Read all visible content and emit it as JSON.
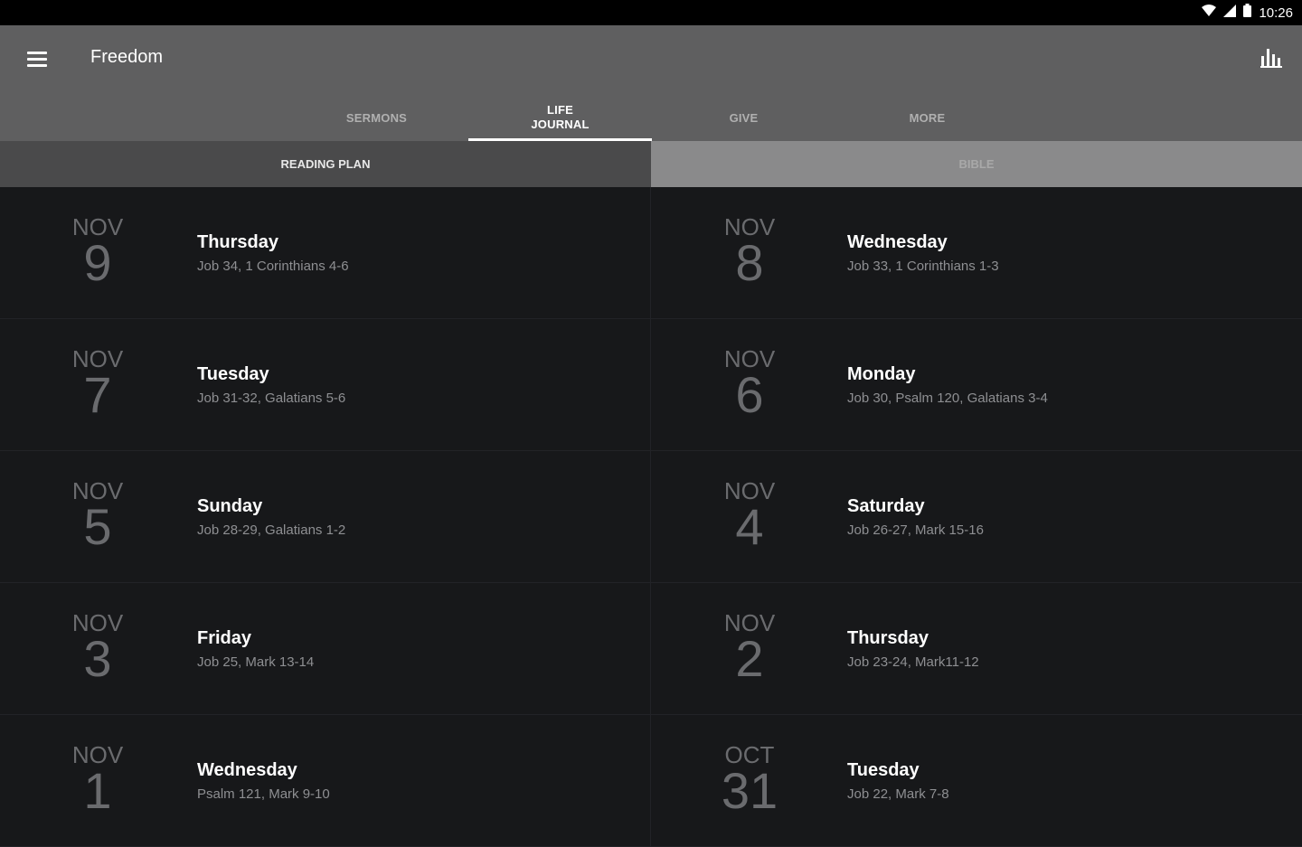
{
  "status_bar": {
    "time": "10:26",
    "icons": [
      "wifi-icon",
      "signal-icon",
      "battery-icon"
    ]
  },
  "toolbar": {
    "menu_icon": "menu-icon",
    "title": "Freedom",
    "stats_icon": "bar-chart-icon"
  },
  "tabs": [
    {
      "label": "SERMONS",
      "active": false
    },
    {
      "label": "LIFE\nJOURNAL",
      "active": true
    },
    {
      "label": "GIVE",
      "active": false
    },
    {
      "label": "MORE",
      "active": false
    }
  ],
  "subtabs": [
    {
      "label": "READING PLAN",
      "active": true
    },
    {
      "label": "BIBLE",
      "active": false
    }
  ],
  "entries": [
    {
      "month": "NOV",
      "day": "9",
      "weekday": "Thursday",
      "reading": "Job 34, 1 Corinthians 4-6"
    },
    {
      "month": "NOV",
      "day": "8",
      "weekday": "Wednesday",
      "reading": "Job 33, 1 Corinthians 1-3"
    },
    {
      "month": "NOV",
      "day": "7",
      "weekday": "Tuesday",
      "reading": "Job 31-32, Galatians 5-6"
    },
    {
      "month": "NOV",
      "day": "6",
      "weekday": "Monday",
      "reading": "Job 30, Psalm 120, Galatians 3-4"
    },
    {
      "month": "NOV",
      "day": "5",
      "weekday": "Sunday",
      "reading": "Job 28-29, Galatians 1-2"
    },
    {
      "month": "NOV",
      "day": "4",
      "weekday": "Saturday",
      "reading": "Job 26-27, Mark 15-16"
    },
    {
      "month": "NOV",
      "day": "3",
      "weekday": "Friday",
      "reading": "Job 25, Mark 13-14"
    },
    {
      "month": "NOV",
      "day": "2",
      "weekday": "Thursday",
      "reading": "Job 23-24, Mark11-12"
    },
    {
      "month": "NOV",
      "day": "1",
      "weekday": "Wednesday",
      "reading": "Psalm 121, Mark 9-10"
    },
    {
      "month": "OCT",
      "day": "31",
      "weekday": "Tuesday",
      "reading": "Job 22, Mark 7-8"
    }
  ]
}
